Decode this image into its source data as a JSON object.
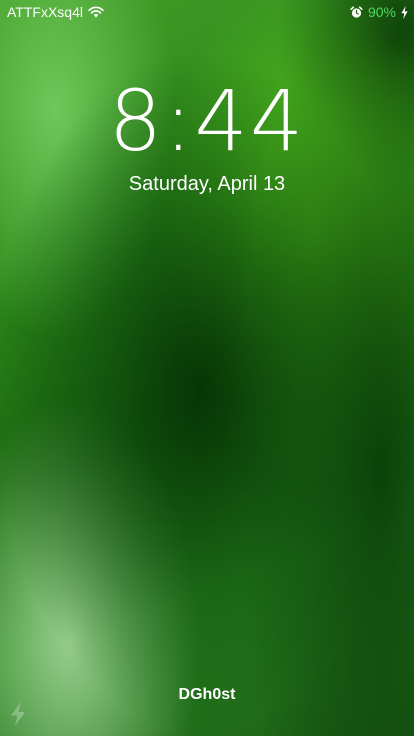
{
  "status_bar": {
    "carrier": "ATTFxXsq4l",
    "battery_percent": "90%",
    "icons": [
      "wifi-icon",
      "alarm-icon",
      "charging-bolt-icon"
    ],
    "battery_color": "#4cd964"
  },
  "lock_screen": {
    "time": "8:44",
    "date": "Saturday, April 13",
    "owner_name": "DGh0st"
  },
  "controls": {
    "flashlight_icon": "flashlight-bolt-icon"
  },
  "colors": {
    "text": "#ffffff",
    "wallpaper_primary": "#2f8a1a",
    "wallpaper_dark": "#0a3d0a"
  }
}
